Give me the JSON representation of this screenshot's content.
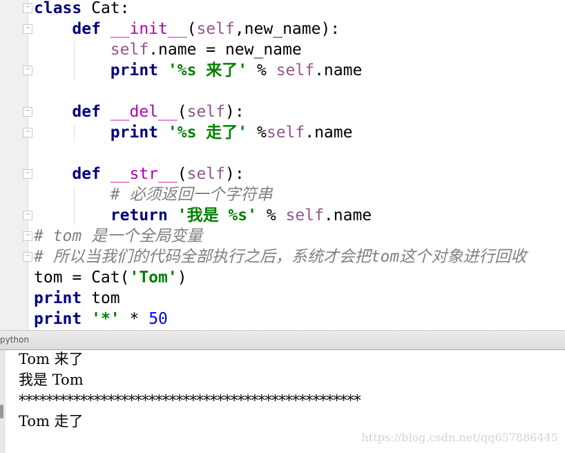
{
  "code": [
    [
      {
        "t": "class",
        "k": "kw"
      },
      {
        "t": " Cat:",
        "k": ""
      }
    ],
    [
      {
        "t": "    ",
        "k": ""
      },
      {
        "t": "def",
        "k": "kw"
      },
      {
        "t": " ",
        "k": ""
      },
      {
        "t": "__init__",
        "k": "magic"
      },
      {
        "t": "(",
        "k": ""
      },
      {
        "t": "self",
        "k": "self"
      },
      {
        "t": ",new_name):",
        "k": ""
      }
    ],
    [
      {
        "t": "        ",
        "k": ""
      },
      {
        "t": "self",
        "k": "self"
      },
      {
        "t": ".name = new_name",
        "k": ""
      }
    ],
    [
      {
        "t": "        ",
        "k": ""
      },
      {
        "t": "print",
        "k": "kw"
      },
      {
        "t": " ",
        "k": ""
      },
      {
        "t": "'%s 来了'",
        "k": "str"
      },
      {
        "t": " % ",
        "k": ""
      },
      {
        "t": "self",
        "k": "self"
      },
      {
        "t": ".name",
        "k": ""
      }
    ],
    [],
    [
      {
        "t": "    ",
        "k": ""
      },
      {
        "t": "def",
        "k": "kw"
      },
      {
        "t": " ",
        "k": ""
      },
      {
        "t": "__del__",
        "k": "magic"
      },
      {
        "t": "(",
        "k": ""
      },
      {
        "t": "self",
        "k": "self"
      },
      {
        "t": "):",
        "k": ""
      }
    ],
    [
      {
        "t": "        ",
        "k": ""
      },
      {
        "t": "print",
        "k": "kw"
      },
      {
        "t": " ",
        "k": ""
      },
      {
        "t": "'%s 走了'",
        "k": "str"
      },
      {
        "t": " %",
        "k": ""
      },
      {
        "t": "self",
        "k": "self"
      },
      {
        "t": ".name",
        "k": ""
      }
    ],
    [],
    [
      {
        "t": "    ",
        "k": ""
      },
      {
        "t": "def",
        "k": "kw"
      },
      {
        "t": " ",
        "k": ""
      },
      {
        "t": "__str__",
        "k": "magic"
      },
      {
        "t": "(",
        "k": ""
      },
      {
        "t": "self",
        "k": "self"
      },
      {
        "t": "):",
        "k": ""
      }
    ],
    [
      {
        "t": "        ",
        "k": ""
      },
      {
        "t": "# 必须返回一个字符串",
        "k": "cmt"
      }
    ],
    [
      {
        "t": "        ",
        "k": ""
      },
      {
        "t": "return",
        "k": "kw"
      },
      {
        "t": " ",
        "k": ""
      },
      {
        "t": "'我是 %s'",
        "k": "str"
      },
      {
        "t": " % ",
        "k": ""
      },
      {
        "t": "self",
        "k": "self"
      },
      {
        "t": ".name",
        "k": ""
      }
    ],
    [
      {
        "t": "# tom 是一个全局变量",
        "k": "cmt"
      }
    ],
    [
      {
        "t": "# 所以当我们的代码全部执行之后，系统才会把tom这个对象进行回收",
        "k": "cmt"
      }
    ],
    [
      {
        "t": "tom = Cat(",
        "k": ""
      },
      {
        "t": "'Tom'",
        "k": "str"
      },
      {
        "t": ")",
        "k": ""
      }
    ],
    [
      {
        "t": "print",
        "k": "kw"
      },
      {
        "t": " tom",
        "k": ""
      }
    ],
    [
      {
        "t": "print",
        "k": "kw"
      },
      {
        "t": " ",
        "k": ""
      },
      {
        "t": "'*'",
        "k": "str"
      },
      {
        "t": " * ",
        "k": ""
      },
      {
        "t": "50",
        "k": "num"
      }
    ]
  ],
  "panel": {
    "title": "python"
  },
  "output": [
    "Tom 来了",
    "我是 Tom",
    "**************************************************",
    "Tom 走了"
  ],
  "watermark": "https://blog.csdn.net/qq657886445"
}
